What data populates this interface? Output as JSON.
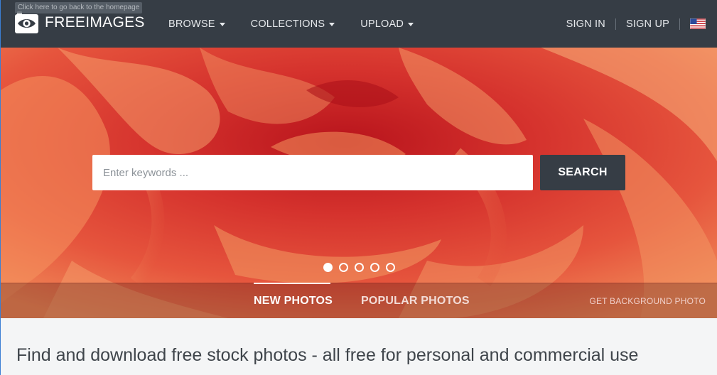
{
  "tooltip": "Click here to go back to the homepage",
  "brand": {
    "name": "FREEIMAGES",
    "icon": "camera-logo-icon"
  },
  "nav": {
    "items": [
      {
        "label": "BROWSE",
        "name": "nav-browse"
      },
      {
        "label": "COLLECTIONS",
        "name": "nav-collections"
      },
      {
        "label": "UPLOAD",
        "name": "nav-upload"
      }
    ],
    "sign_in": "SIGN IN",
    "sign_up": "SIGN UP",
    "language_flag": "us-flag-icon"
  },
  "hero": {
    "search_placeholder": "Enter keywords ...",
    "search_button": "SEARCH",
    "slides": 5,
    "active_slide": 0,
    "tabs": [
      {
        "label": "NEW PHOTOS",
        "active": true
      },
      {
        "label": "POPULAR PHOTOS",
        "active": false
      }
    ],
    "get_background": "GET BACKGROUND PHOTO"
  },
  "tagline": "Find and download free stock photos - all free for personal and commercial use",
  "colors": {
    "navbar": "#363d45",
    "search_button": "#363d45",
    "hero_red": "#d93a33"
  }
}
